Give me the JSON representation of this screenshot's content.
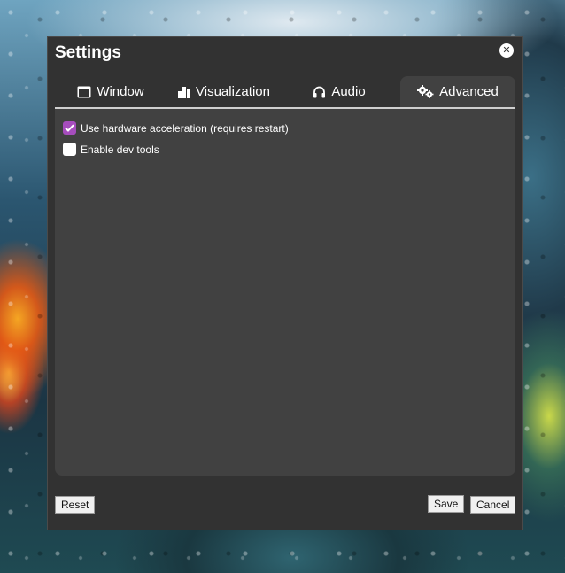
{
  "dialog": {
    "title": "Settings",
    "close_icon": "close-icon"
  },
  "tabs": [
    {
      "label": "Window",
      "icon": "window-icon",
      "active": false
    },
    {
      "label": "Visualization",
      "icon": "bar-chart-icon",
      "active": false
    },
    {
      "label": "Audio",
      "icon": "headphones-icon",
      "active": false
    },
    {
      "label": "Advanced",
      "icon": "gears-icon",
      "active": true
    }
  ],
  "advanced": {
    "options": [
      {
        "label": "Use hardware acceleration (requires restart)",
        "checked": true
      },
      {
        "label": "Enable dev tools",
        "checked": false
      }
    ]
  },
  "footer": {
    "reset_label": "Reset",
    "save_label": "Save",
    "cancel_label": "Cancel"
  },
  "colors": {
    "accent": "#a64dbd",
    "dialog_bg": "#323232",
    "panel_bg": "#414141"
  }
}
